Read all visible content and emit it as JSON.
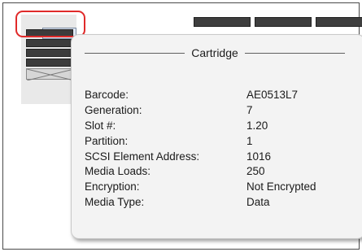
{
  "popup": {
    "title": "Cartridge",
    "rows": [
      {
        "label": "Barcode:",
        "value": "AE0513L7"
      },
      {
        "label": "Generation:",
        "value": "7"
      },
      {
        "label": "Slot #:",
        "value": "1.20"
      },
      {
        "label": "Partition:",
        "value": "1"
      },
      {
        "label": "SCSI Element Address:",
        "value": "1016"
      },
      {
        "label": "Media Loads:",
        "value": "250"
      },
      {
        "label": "Encryption:",
        "value": "Not Encrypted"
      },
      {
        "label": "Media Type:",
        "value": "Data"
      }
    ]
  },
  "colors": {
    "highlight": "#e02a2a",
    "popup_background": "#f3f3f3",
    "slot_dark": "#3c3c3c",
    "selected_cartridge": "#dfe7f2"
  },
  "icons": [
    "barcode-icon",
    "empty-slot-icon"
  ]
}
